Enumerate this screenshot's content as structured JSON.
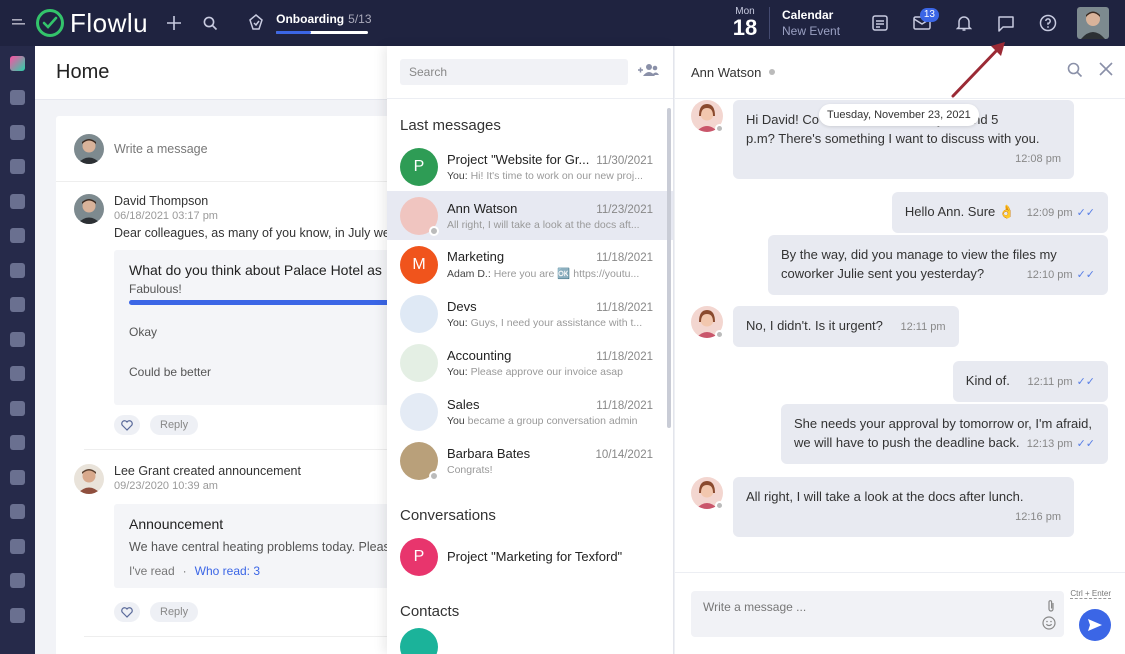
{
  "topbar": {
    "logo_text": "Flowlu",
    "onboarding": {
      "title": "Onboarding",
      "count": "5/13",
      "progress": 0.38
    },
    "date": {
      "dow": "Mon",
      "day": "18"
    },
    "calendar": {
      "title": "Calendar",
      "sub": "New Event"
    },
    "mail_badge": "13"
  },
  "home": {
    "title": "Home",
    "composer_placeholder": "Write a message",
    "post1": {
      "author": "David Thompson",
      "date": "06/18/2021 03:17 pm",
      "body": "Dear colleagues, as many of you know, in July we w",
      "poll_question": "What do you think about Palace Hotel as",
      "options": [
        "Fabulous!",
        "Okay",
        "Could be better"
      ],
      "reply": "Reply"
    },
    "post2": {
      "author": "Lee Grant",
      "action": "created announcement",
      "date": "09/23/2020 10:39 am",
      "ann_title": "Announcement",
      "ann_text": "We have central heating problems today. Please",
      "ive_read": "I've read",
      "dot": "·",
      "who_read": "Who read: 3",
      "reply": "Reply"
    }
  },
  "chatlist": {
    "search_placeholder": "Search",
    "section_last": "Last messages",
    "section_conv": "Conversations",
    "section_contacts": "Contacts",
    "items": [
      {
        "name": "Project \"Website for Gr...",
        "date": "11/30/2021",
        "sender": "You:",
        "preview": "Hi! It's time to work on our new proj...",
        "letter": "P",
        "color": "#2e9c55"
      },
      {
        "name": "Ann Watson",
        "date": "11/23/2021",
        "sender": "",
        "preview": "All right, I will take a look at the docs aft...",
        "letter": "",
        "color": "#f0c5c0"
      },
      {
        "name": "Marketing",
        "date": "11/18/2021",
        "sender": "Adam D.:",
        "preview": "Here you are 🆗 https://youtu...",
        "letter": "M",
        "color": "#f0541c"
      },
      {
        "name": "Devs",
        "date": "11/18/2021",
        "sender": "You:",
        "preview": "Guys, I need your assistance with t...",
        "letter": "",
        "color": "#dfe9f5"
      },
      {
        "name": "Accounting",
        "date": "11/18/2021",
        "sender": "You:",
        "preview": "Please approve our invoice asap",
        "letter": "",
        "color": "#e4efe4"
      },
      {
        "name": "Sales",
        "date": "11/18/2021",
        "sender": "You",
        "preview": "became a group conversation admin",
        "letter": "",
        "color": "#e4ebf5"
      },
      {
        "name": "Barbara Bates",
        "date": "10/14/2021",
        "sender": "",
        "preview": "Congrats!",
        "letter": "",
        "color": "#b9a07a"
      }
    ],
    "conversations": [
      {
        "name": "Project \"Marketing for Texford\"",
        "letter": "P",
        "color": "#e8356d"
      }
    ]
  },
  "conversation": {
    "name": "Ann Watson",
    "date_pill": "Tuesday, November 23, 2021",
    "messages": [
      {
        "dir": "in",
        "lines": [
          "Hi David! Co",
          "p.m? There's something I want to discuss with you."
        ],
        "line1_tail": "y around 5",
        "time": "12:08 pm"
      },
      {
        "dir": "out",
        "text": "Hello Ann. Sure 👌",
        "time": "12:09 pm"
      },
      {
        "dir": "out",
        "lines": [
          "By the way, did you manage to view the files my",
          "coworker Julie sent you yesterday?"
        ],
        "time": "12:10 pm"
      },
      {
        "dir": "in",
        "text": "No, I didn't. Is it urgent?",
        "time": "12:11 pm"
      },
      {
        "dir": "out",
        "text": "Kind of.",
        "time": "12:11 pm"
      },
      {
        "dir": "out",
        "lines": [
          "She needs your approval by tomorrow or, I'm afraid,",
          "we will have to push the deadline back."
        ],
        "time": "12:13 pm"
      },
      {
        "dir": "in",
        "text": "All right, I will take a look at the docs after lunch.",
        "time": "12:16 pm"
      }
    ],
    "composer_placeholder": "Write a message ...",
    "hint": "Ctrl + Enter"
  },
  "colors": {
    "topbar": "#1f2340",
    "accent": "#3b66e6",
    "nav": "#262a4a",
    "arrow": "#9b2a35"
  }
}
